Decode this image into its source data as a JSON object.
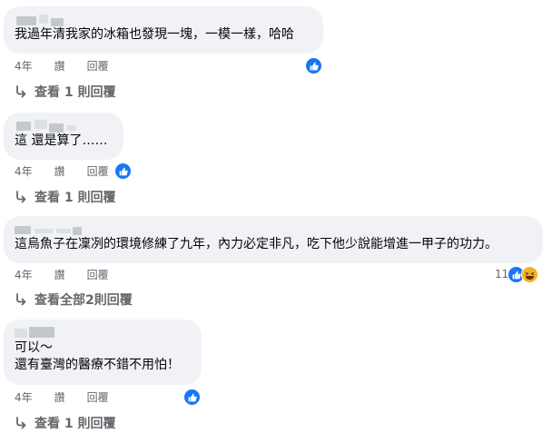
{
  "comments": [
    {
      "text_lines": [
        "我過年清我家的冰箱也發現一塊，一模一樣，哈哈"
      ],
      "time": "4年",
      "like_label": "讚",
      "reply_label": "回覆",
      "reaction_icons": [
        "like-icon"
      ],
      "reaction_count": "",
      "view_replies": "查看 1 則回覆"
    },
    {
      "text_lines": [
        "這 還是算了……"
      ],
      "time": "4年",
      "like_label": "讚",
      "reply_label": "回覆",
      "reaction_icons": [
        "like-icon"
      ],
      "reaction_count": "",
      "view_replies": "查看 1 則回覆"
    },
    {
      "text_lines": [
        "這烏魚子在凜冽的環境修練了九年，內力必定非凡，吃下他少說能增進一甲子的功力。"
      ],
      "time": "4年",
      "like_label": "讚",
      "reply_label": "回覆",
      "reaction_icons": [
        "like-icon",
        "haha-icon"
      ],
      "reaction_count": "11",
      "view_replies": "查看全部2則回覆"
    },
    {
      "text_lines": [
        "可以～",
        "還有臺灣的醫療不錯不用怕！"
      ],
      "time": "4年",
      "like_label": "讚",
      "reply_label": "回覆",
      "reaction_icons": [
        "like-icon"
      ],
      "reaction_count": "",
      "view_replies": "查看 1 則回覆"
    }
  ],
  "colors": {
    "bubble": "#f0f2f5",
    "meta": "#65676b",
    "like": "#1877f2",
    "haha": "#f7b125"
  }
}
